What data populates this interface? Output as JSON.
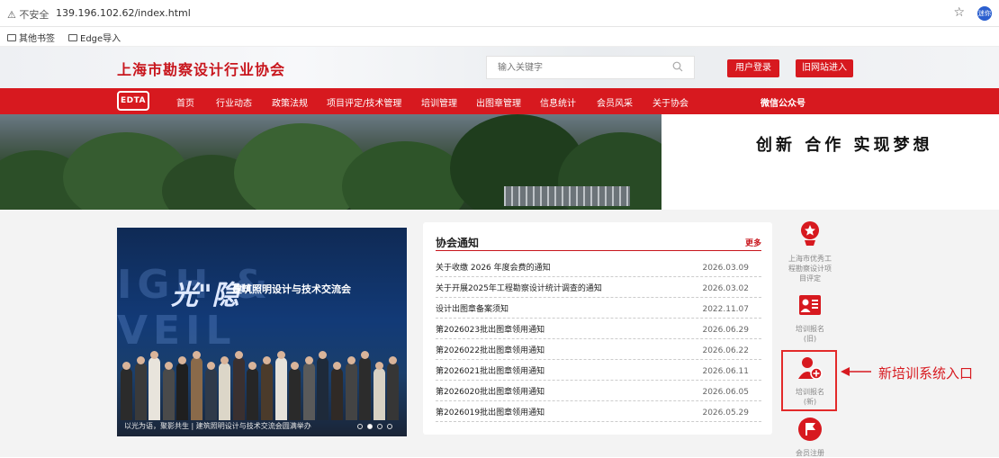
{
  "browser": {
    "warning": "⚠ 不安全",
    "url": "139.196.102.62/index.html",
    "avatar": "迷你",
    "bookmarks": [
      "其他书签",
      "Edge导入"
    ]
  },
  "header": {
    "title": "上海市勘察设计行业协会",
    "search_placeholder": "输入关键字",
    "login": "用户登录",
    "old_site": "旧网站进入"
  },
  "nav": {
    "logo": "EDTA",
    "items": [
      "首页",
      "行业动态",
      "政策法规",
      "项目评定/技术管理",
      "培训管理",
      "出图章管理",
      "信息统计",
      "会员风采",
      "关于协会",
      "微信公众号"
    ]
  },
  "banner": {
    "slogan": "创新 合作 实现梦想"
  },
  "photo": {
    "headline": "光\"隐\"",
    "subtitle": "建筑照明设计与技术交流会",
    "bg_text": "IGH & VEIL",
    "caption": "以光为语，聚影共生 | 建筑照明设计与技术交流会圆满举办"
  },
  "notice": {
    "title": "协会通知",
    "more": "更多",
    "items": [
      {
        "title": "关于收缴 2026 年度会费的通知",
        "date": "2026.03.09"
      },
      {
        "title": "关于开展2025年工程勘察设计统计调查的通知",
        "date": "2026.03.02"
      },
      {
        "title": "设计出图章备案须知",
        "date": "2022.11.07"
      },
      {
        "title": "第2026023批出图章领用通知",
        "date": "2026.06.29"
      },
      {
        "title": "第2026022批出图章领用通知",
        "date": "2026.06.22"
      },
      {
        "title": "第2026021批出图章领用通知",
        "date": "2026.06.11"
      },
      {
        "title": "第2026020批出图章领用通知",
        "date": "2026.06.05"
      },
      {
        "title": "第2026019批出图章领用通知",
        "date": "2026.05.29"
      }
    ]
  },
  "side": {
    "items": [
      {
        "label1": "上海市优秀工",
        "label2": "程勘察设计项",
        "label3": "目评定",
        "icon": "trophy-icon"
      },
      {
        "label1": "培训报名",
        "label2": "(旧)",
        "icon": "id-card-icon"
      },
      {
        "label1": "培训报名",
        "label2": "(新)",
        "icon": "user-add-icon"
      },
      {
        "label1": "会员注册",
        "icon": "flag-icon"
      }
    ],
    "annotation": "新培训系统入口"
  },
  "colors": {
    "brand_red": "#d7191f"
  }
}
